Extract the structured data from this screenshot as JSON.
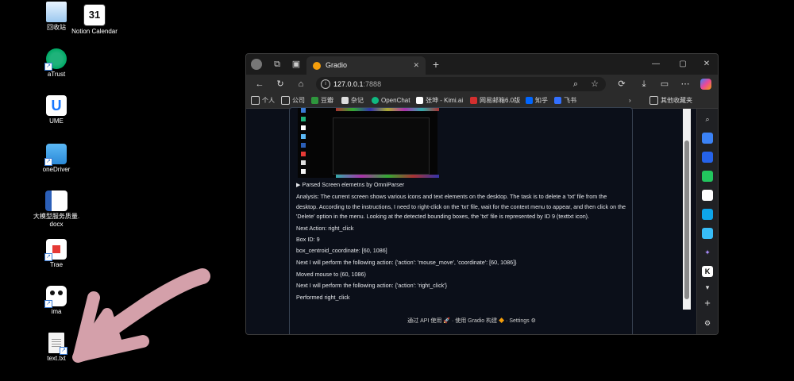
{
  "desktop": {
    "icons": [
      {
        "label": "回收站"
      },
      {
        "label": "Notion Calendar",
        "day": "31"
      },
      {
        "label": "aTrust"
      },
      {
        "label": "UME"
      },
      {
        "label": "oneDriver"
      },
      {
        "label": "大模型服务质量.docx"
      },
      {
        "label": "Trae"
      },
      {
        "label": "ima"
      },
      {
        "label": "text.txt"
      }
    ]
  },
  "browser": {
    "tab_title": "Gradio",
    "url_host": "127.0.0.1",
    "url_port": ":7888",
    "bookmarks": [
      {
        "label": "个人"
      },
      {
        "label": "公司"
      },
      {
        "label": "豆瓣"
      },
      {
        "label": "杂记"
      },
      {
        "label": "OpenChat"
      },
      {
        "label": "张坤 - Kimi.ai"
      },
      {
        "label": "网易邮箱6.0版"
      },
      {
        "label": "知乎"
      },
      {
        "label": "飞书"
      }
    ],
    "other_favorites": "其他收藏夹"
  },
  "gradio": {
    "accordion_label": "▶ Parsed Screen elemetns by OmniParser",
    "analysis": "Analysis: The current screen shows various icons and text elements on the desktop. The task is to delete a 'txt' file from the desktop. According to the instructions, I need to right-click on the 'txt' file, wait for the context menu to appear, and then click on the 'Delete' option in the menu. Looking at the detected bounding boxes, the 'txt' file is represented by ID 9 (texttxt icon).",
    "next_action": "Next Action: right_click",
    "box_id": "Box ID: 9",
    "centroid": "box_centroid_coordinate: [60, 1086]",
    "step1": "Next I will perform the following action: {'action': 'mouse_move', 'coordinate': [60, 1086]}",
    "step1_result": "Moved mouse to (60, 1086)",
    "step2": "Next I will perform the following action: {'action': 'right_click'}",
    "step2_result": "Performed right_click",
    "footer_api": "通过 API 使用",
    "footer_built": "使用 Gradio 构建",
    "footer_settings": "Settings"
  },
  "colors": {
    "annotation_arrow": "#d4a0aa"
  }
}
